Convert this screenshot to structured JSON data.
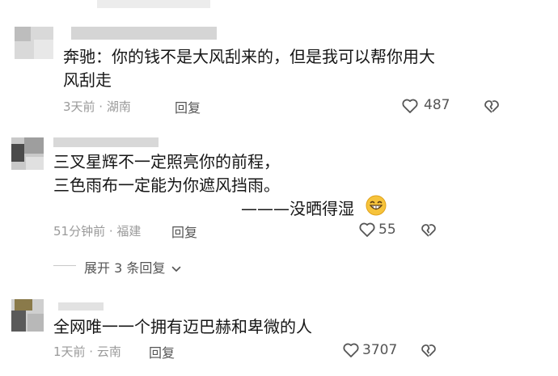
{
  "comments": [
    {
      "text_line1": "奔驰：你的钱不是大风刮来的，但是我可以帮你用大",
      "text_line2": "风刮走",
      "meta": "3天前 · 湖南",
      "reply_label": "回复",
      "likes": "487"
    },
    {
      "text_line1": "三叉星辉不一定照亮你的前程，",
      "text_line2": "三色雨布一定能为你遮风挡雨。",
      "signature": "———没晒得湿",
      "emoji": "😁",
      "meta": "51分钟前 · 福建",
      "reply_label": "回复",
      "likes": "55"
    },
    {
      "text": "全网唯一一个拥有迈巴赫和卑微的人",
      "meta": "1天前 · 云南",
      "reply_label": "回复",
      "likes": "3707"
    }
  ],
  "expand_replies": "展开 3 条回复",
  "icons": {
    "like": "heart-outline-icon",
    "dislike": "broken-heart-icon",
    "expand": "chevron-down-icon"
  },
  "colors": {
    "meta": "#9a9a9a",
    "text": "#161616"
  }
}
